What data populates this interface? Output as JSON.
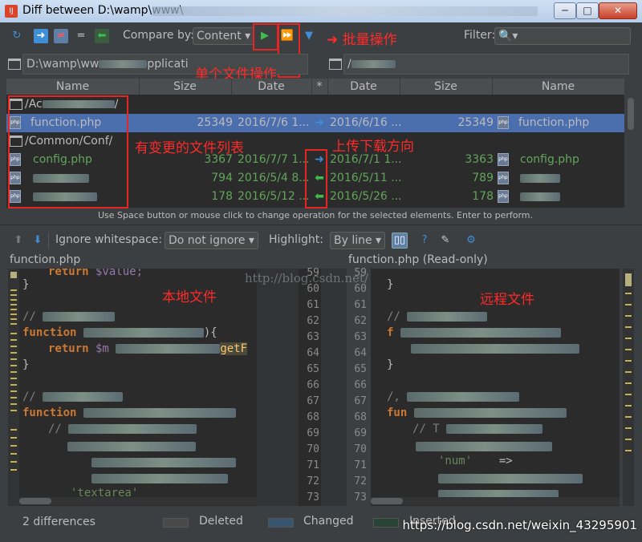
{
  "window": {
    "title": "Diff between D:\\wamp\\www\\"
  },
  "toolbar": {
    "compare_by_label": "Compare by:",
    "compare_by_value": "Content",
    "filter_label": "Filter:",
    "annotation_single": "单个文件操作",
    "annotation_batch": "批量操作"
  },
  "paths": {
    "left": "D:\\wamp\\ww",
    "left_tail": "pplicati",
    "right": "/"
  },
  "table": {
    "headers": [
      "Name",
      "Size",
      "Date",
      "*",
      "Date",
      "Size",
      "Name"
    ],
    "rows": [
      {
        "type": "folder",
        "left_name": "/Ac",
        "left_tail": "/"
      },
      {
        "type": "file",
        "left_name": "function.php",
        "left_size": "25349",
        "left_date": "2016/7/6 1...",
        "right_date": "2016/6/16 ...",
        "right_size": "25349",
        "right_name": "function.php",
        "selected": true,
        "direction": "right"
      },
      {
        "type": "folder",
        "left_name": "/Common/Conf/"
      },
      {
        "type": "file",
        "left_name": "config.php",
        "left_size": "3367",
        "left_date": "2016/7/7 1...",
        "right_date": "2016/7/1 1...",
        "right_size": "3363",
        "right_name": "config.php",
        "direction": "right"
      },
      {
        "type": "file",
        "left_name": "",
        "left_size": "794",
        "left_date": "2016/5/4 8...",
        "right_date": "2016/5/11 ...",
        "right_size": "789",
        "right_name": "",
        "direction": "left"
      },
      {
        "type": "file",
        "left_name": "",
        "left_size": "178",
        "left_date": "2016/5/12 ...",
        "right_date": "2016/5/26 ...",
        "right_size": "178",
        "right_name": "",
        "direction": "left"
      }
    ],
    "annotation_list": "有变更的文件列表",
    "annotation_direction": "上传下载方向",
    "hint": "Use Space button or mouse click to change operation for the selected elements. Enter to perform."
  },
  "diff_toolbar": {
    "ignore_whitespace_label": "Ignore whitespace:",
    "ignore_whitespace_value": "Do not ignore",
    "highlight_label": "Highlight:",
    "highlight_value": "By line"
  },
  "editors": {
    "left_title": "function.php",
    "right_title": "function.php (Read-only)",
    "annotation_local": "本地文件",
    "annotation_remote": "远程文件",
    "left_lines": [
      {
        "t": "return",
        "rest": " $value;"
      },
      {
        "t": "}",
        "rest": ""
      },
      {
        "t": "",
        "rest": ""
      },
      {
        "t": "//",
        "rest": ""
      },
      {
        "t": "function",
        "rest": ""
      },
      {
        "t": "return",
        "rest": " $m"
      },
      {
        "t": "}",
        "rest": ""
      },
      {
        "t": "",
        "rest": ""
      },
      {
        "t": "//",
        "rest": ""
      },
      {
        "t": "function",
        "rest": ""
      },
      {
        "t": "//",
        "rest": ""
      },
      {
        "t": "",
        "rest": ""
      },
      {
        "t": "",
        "rest": ""
      },
      {
        "t": "",
        "rest": ""
      },
      {
        "t": "'textarea'",
        "rest": ""
      }
    ],
    "getf": "getF",
    "line_numbers": [
      "59",
      "60",
      "61",
      "62",
      "63",
      "64",
      "65",
      "66",
      "67",
      "68",
      "69",
      "70",
      "71",
      "72",
      "73"
    ],
    "right_snippets": {
      "num": "'num'",
      "arrow": "=>",
      "t": "// T"
    },
    "watermark": "http://blog.csdn.net/"
  },
  "status": {
    "differences": "2 differences",
    "deleted": "Deleted",
    "changed": "Changed",
    "inserted": "Inserted",
    "footer_watermark": "https://blog.csdn.net/weixin_43295901"
  },
  "colors": {
    "accent_red": "#e52521",
    "selected_row": "#4b6eaf",
    "green_text": "#62a55a"
  }
}
